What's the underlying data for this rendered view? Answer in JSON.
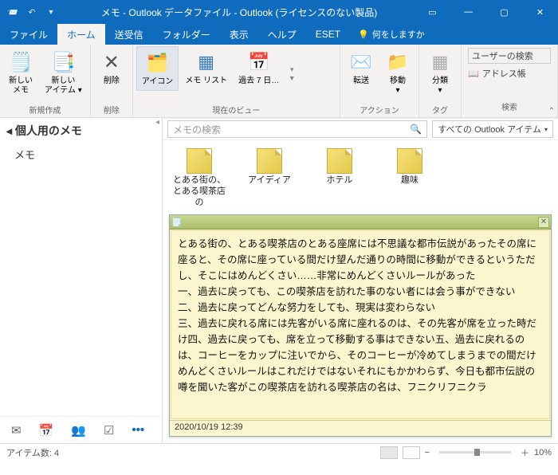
{
  "title": "メモ - Outlook データファイル - Outlook (ライセンスのない製品)",
  "tabs": {
    "file": "ファイル",
    "home": "ホーム",
    "sendrecv": "送受信",
    "folder": "フォルダー",
    "view": "表示",
    "help": "ヘルプ",
    "eset": "ESET",
    "tellme": "何をしますか"
  },
  "ribbon": {
    "new": {
      "newMemo": "新しい\nメモ",
      "newItem": "新しい\nアイテム ▾",
      "group": "新規作成"
    },
    "delete": {
      "btn": "削除",
      "group": "削除"
    },
    "view": {
      "icons": "アイコン",
      "memoList": "メモ リスト",
      "last7": "過去 7 日…",
      "group": "現在のビュー"
    },
    "actions": {
      "forward": "転送",
      "move": "移動\n▾",
      "group": "アクション"
    },
    "tag": {
      "category": "分類\n▾",
      "group": "タグ"
    },
    "search": {
      "user": "ユーザーの検索",
      "address": "アドレス帳",
      "group": "検索"
    }
  },
  "left": {
    "header": "個人用のメモ",
    "item": "メモ"
  },
  "toolbar": {
    "placeholder": "メモの検索",
    "scope": "すべての Outlook アイテム"
  },
  "notes": {
    "n1": "とある街の、とある喫茶店の",
    "n2": "アイディア",
    "n3": "ホテル",
    "n4": "趣味"
  },
  "preview": {
    "body": "とある街の、とある喫茶店のとある座席には不思議な都市伝説があったその席に座ると、その席に座っている間だけ望んだ通りの時間に移動ができるというただし、そこにはめんどくさい……非常にめんどくさいルールがあった\n一、過去に戻っても、この喫茶店を訪れた事のない者には会う事ができない\n二、過去に戻ってどんな努力をしても、現実は変わらない\n三、過去に戻れる席には先客がいる席に座れるのは、その先客が席を立った時だけ四、過去に戻っても、席を立って移動する事はできない五、過去に戻れるのは、コーヒーをカップに注いでから、そのコーヒーが冷めてしまうまでの間だけめんどくさいルールはこれだけではないそれにもかかわらず、今日も都市伝説の噂を聞いた客がこの喫茶店を訪れる喫茶店の名は、フニクリフニクラ",
    "timestamp": "2020/10/19 12:39"
  },
  "status": {
    "count": "アイテム数:  4",
    "zoom": "10%"
  }
}
